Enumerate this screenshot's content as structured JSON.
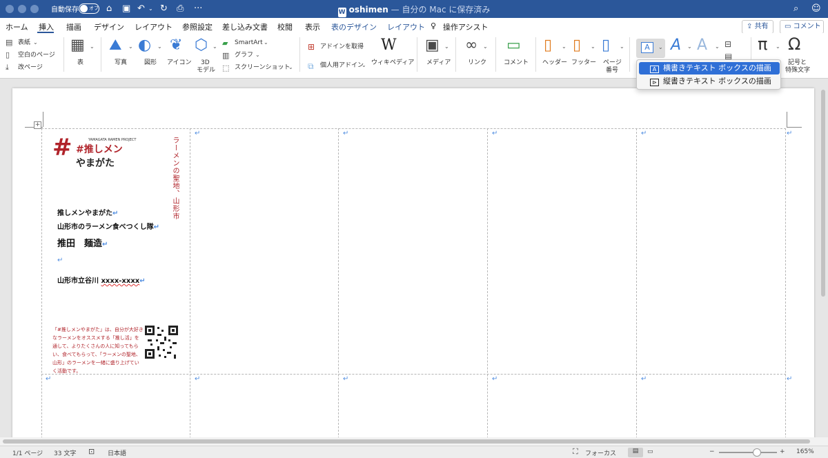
{
  "titlebar": {
    "autosave_label": "自動保存",
    "autosave_state": "オフ",
    "doc_name": "oshimen",
    "doc_status": " — 自分の Mac に保存済み",
    "doc_icon": "W",
    "more": "···"
  },
  "tabs": [
    "ホーム",
    "挿入",
    "描画",
    "デザイン",
    "レイアウト",
    "参照設定",
    "差し込み文書",
    "校閲",
    "表示",
    "表のデザイン",
    "レイアウト",
    "操作アシスト"
  ],
  "share_label": "共有",
  "comment_label": "コメント",
  "ribbon": {
    "cover": "表紙",
    "blank_page": "空白のページ",
    "page_break": "改ページ",
    "table": "表",
    "pictures": "写真",
    "shapes": "図形",
    "icons": "アイコン",
    "models3d_1": "3D",
    "models3d_2": "モデル",
    "smartart": "SmartArt",
    "chart": "グラフ",
    "screenshot": "スクリーンショット",
    "get_addins": "アドインを取得",
    "my_addins": "個人用アドイン",
    "wikipedia": "ウィキペディア",
    "wikipedia_glyph": "W",
    "media": "メディア",
    "link": "リンク",
    "comment": "コメント",
    "header": "ヘッダー",
    "footer": "フッター",
    "page_number_1": "ページ",
    "page_number_2": "番号",
    "textbox_glyph": "A",
    "equation_glyph": "π",
    "symbol_glyph": "Ω",
    "symbols_1": "記号と",
    "symbols_2": "特殊文字"
  },
  "textbox_menu": {
    "horizontal": "横書きテキスト ボックスの描画",
    "vertical": "縦書きテキスト ボックスの描画"
  },
  "card": {
    "logo_line1": "#推しメン",
    "logo_line2": "やまがた",
    "logo_tag": "YAMAGATA RAMEN PROJECT",
    "vertical_tagline": "ラーメンの聖地、山形市",
    "line1": "推しメンやまがた",
    "line2": "山形市のラーメン食べつくし隊",
    "name": "推田　麺造",
    "address": "山形市立谷川 ",
    "phone": "xxxx-xxxx",
    "promo": "「#推しメンやまがた」は、自分が大好きなラーメンをオススメする「推し活」を通して、よりたくさんの人に知ってもらい、食べてもらって、「ラーメンの聖地、山形」のラーメンを一緒に盛り上げていく活動です。"
  },
  "return_mark": "↵",
  "status": {
    "page": "1/1 ページ",
    "words": "33 文字",
    "language": "日本語",
    "focus": "フォーカス",
    "zoom": "165%"
  },
  "colors": {
    "brand": "#2b579a",
    "accent_red": "#b0232a",
    "menu_selected": "#2f6fd6"
  },
  "zoom_fraction": 0.65
}
